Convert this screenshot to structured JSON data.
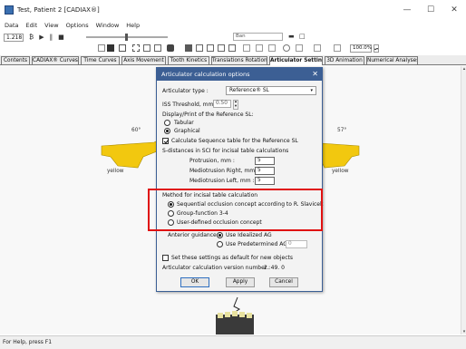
{
  "window": {
    "title": "Test, Patient 2 [CADIAX®]",
    "controls": [
      "—",
      "☐",
      "✕"
    ]
  },
  "menu": [
    "Data",
    "Edit",
    "View",
    "Options",
    "Window",
    "Help"
  ],
  "toolbar": {
    "value_field": "1.218",
    "playback": [
      "₿",
      "▶",
      "‖",
      "■"
    ],
    "combo_text": "Ban",
    "zoom": "100.0%"
  },
  "tabs": [
    {
      "label": "Contents",
      "active": false
    },
    {
      "label": "CADIAX® Curves",
      "active": false
    },
    {
      "label": "Time Curves",
      "active": false
    },
    {
      "label": "Axis Movement",
      "active": false
    },
    {
      "label": "Tooth Kinetics",
      "active": false
    },
    {
      "label": "Translations Rotations",
      "active": false
    },
    {
      "label": "Articulator Settings",
      "active": true
    },
    {
      "label": "3D Animation",
      "active": false
    },
    {
      "label": "Numerical Analyses",
      "active": false
    }
  ],
  "canvas": {
    "left_angle": "60°",
    "right_angle": "57°",
    "left_color": "yellow",
    "right_color": "yellow",
    "jaw_color": "#f2c80f"
  },
  "dialog": {
    "title": "Articulator calculation options",
    "articulator_type_label": "Articulator type :",
    "articulator_type_value": "Reference® SL",
    "iss_label": "ISS Threshold, mm:",
    "iss_value": "0.50",
    "display_label": "Display/Print of the Reference SL:",
    "display_options": [
      {
        "label": "Tabular",
        "checked": false
      },
      {
        "label": "Graphical",
        "checked": true
      }
    ],
    "calc_sequence_label": "Calculate Sequence table for the Reference SL",
    "calc_sequence_checked": true,
    "sci_label": "S-distances in SCI for incisal table calculations",
    "protrusion_label": "Protrusion, mm :",
    "protrusion_value": "5",
    "medio_right_label": "Mediotrusion Right, mm :",
    "medio_right_value": "5",
    "medio_left_label": "Mediotrusion Left, mm :",
    "medio_left_value": "5",
    "method_label": "Method for incisal table calculation",
    "method_options": [
      {
        "label": "Sequential occlusion concept according to R. Slavicek",
        "checked": true
      },
      {
        "label": "Group-function 3-4",
        "checked": false
      },
      {
        "label": "User-defined occlusion concept",
        "checked": false
      }
    ],
    "anterior_label": "Anterior guidance",
    "anterior_options": [
      {
        "label": "Use Idealized AG",
        "checked": true
      },
      {
        "label": "Use Predetermined AG :",
        "checked": false
      }
    ],
    "predetermined_value": "0",
    "default_label": "Set these settings as default for new objects",
    "default_checked": false,
    "version_label": "Articulator calculation version number :",
    "version_value": "2. 49. 0",
    "buttons": {
      "ok": "OK",
      "apply": "Apply",
      "cancel": "Cancel"
    },
    "highlight_color": "#e01010"
  },
  "status_bar": "For Help, press F1"
}
